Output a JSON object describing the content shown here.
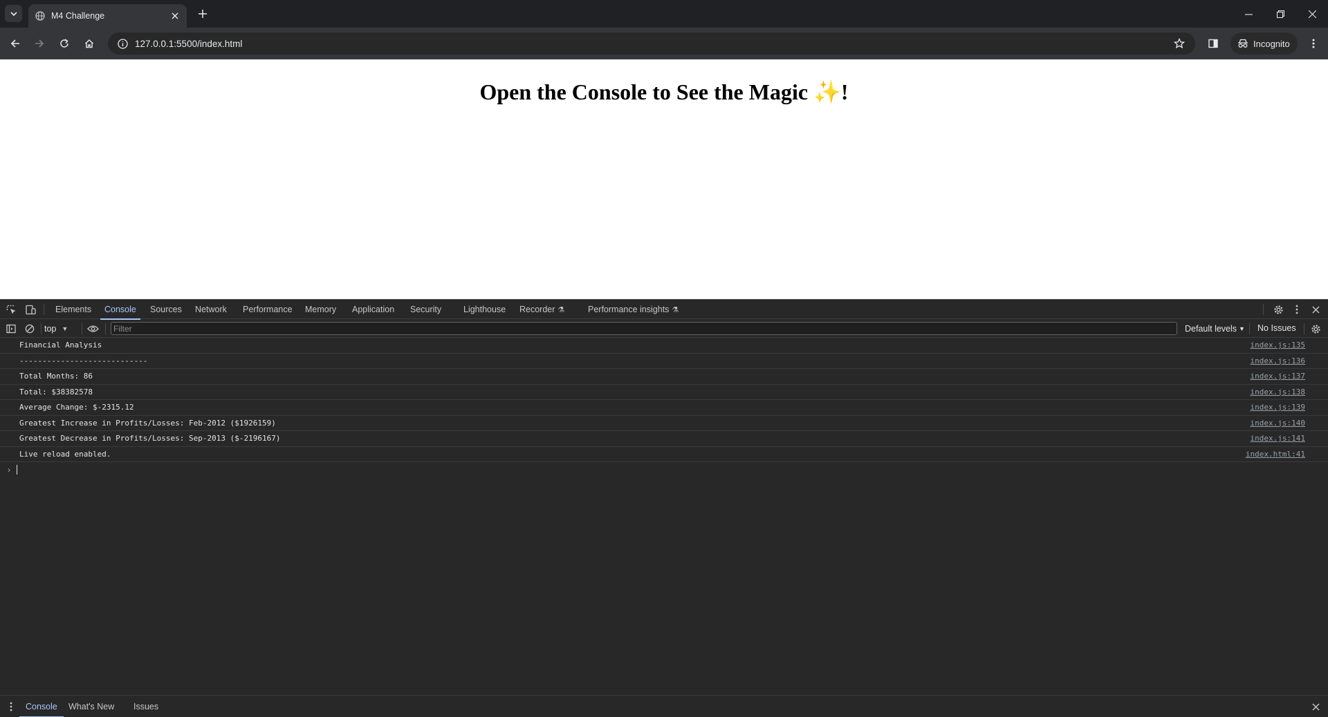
{
  "browser": {
    "tab": {
      "title": "M4 Challenge",
      "favicon": "globe-icon"
    },
    "url": "127.0.0.1:5500/index.html",
    "incognito_label": "Incognito"
  },
  "page": {
    "heading": "Open the Console to See the Magic ✨!"
  },
  "devtools": {
    "tabs": [
      {
        "label": "Elements",
        "active": false
      },
      {
        "label": "Console",
        "active": true
      },
      {
        "label": "Sources",
        "active": false
      },
      {
        "label": "Network",
        "active": false
      },
      {
        "label": "Performance",
        "active": false
      },
      {
        "label": "Memory",
        "active": false
      },
      {
        "label": "Application",
        "active": false
      },
      {
        "label": "Security",
        "active": false
      },
      {
        "label": "Lighthouse",
        "active": false
      },
      {
        "label": "Recorder",
        "active": false,
        "experimental": true
      },
      {
        "label": "Performance insights",
        "active": false,
        "experimental": true
      }
    ],
    "console_toolbar": {
      "context": "top",
      "filter_placeholder": "Filter",
      "levels": "Default levels",
      "issues": "No Issues"
    },
    "logs": [
      {
        "message": "Financial Analysis",
        "source": "index.js:135"
      },
      {
        "message": "----------------------------",
        "source": "index.js:136"
      },
      {
        "message": "Total Months: 86",
        "source": "index.js:137"
      },
      {
        "message": "Total: $38382578",
        "source": "index.js:138"
      },
      {
        "message": "Average Change: $-2315.12",
        "source": "index.js:139"
      },
      {
        "message": "Greatest Increase in Profits/Losses: Feb-2012 ($1926159)",
        "source": "index.js:140"
      },
      {
        "message": "Greatest Decrease in Profits/Losses: Sep-2013 ($-2196167)",
        "source": "index.js:141"
      },
      {
        "message": "Live reload enabled.",
        "source": "index.html:41"
      }
    ],
    "drawer_tabs": [
      {
        "label": "Console",
        "active": true
      },
      {
        "label": "What's New",
        "active": false
      },
      {
        "label": "Issues",
        "active": false
      }
    ]
  },
  "colors": {
    "accent": "#a8c7fa",
    "devtools_bg": "#282828",
    "chrome_bg": "#202124",
    "toolbar_bg": "#35363a"
  }
}
